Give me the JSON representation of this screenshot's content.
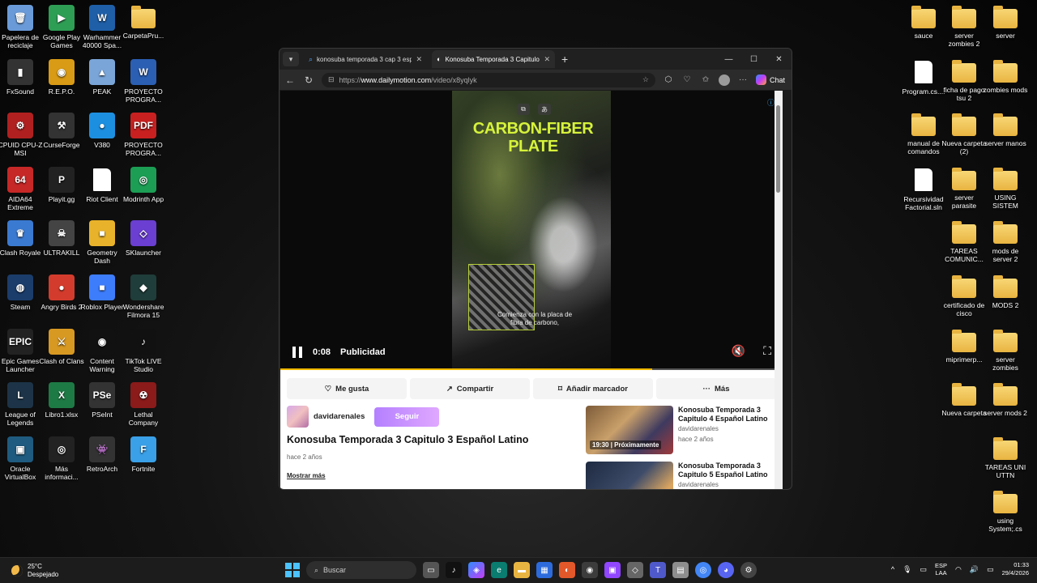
{
  "desktop_left": [
    {
      "label": "Papelera de reciclaje",
      "color": "#6a9bd8",
      "glyph": "🗑"
    },
    {
      "label": "Google Play Games",
      "color": "#2f9e55",
      "glyph": "▶"
    },
    {
      "label": "Warhammer 40000 Spa...",
      "color": "#1f5fa8",
      "glyph": "W"
    },
    {
      "label": "CarpetaPru...",
      "color": "folder",
      "glyph": ""
    },
    {
      "label": "FxSound",
      "color": "#333",
      "glyph": "▮"
    },
    {
      "label": "R.E.P.O.",
      "color": "#d99b16",
      "glyph": "◉"
    },
    {
      "label": "PEAK",
      "color": "#7aa5d8",
      "glyph": "▲"
    },
    {
      "label": "PROYECTO PROGRA...",
      "color": "#2b5fb3",
      "glyph": "W"
    },
    {
      "label": "CPUID CPU-Z MSI",
      "color": "#b02020",
      "glyph": "⚙"
    },
    {
      "label": "CurseForge",
      "color": "#333",
      "glyph": "⚒"
    },
    {
      "label": "V380",
      "color": "#1d8fe0",
      "glyph": "●"
    },
    {
      "label": "PROYECTO PROGRA...",
      "color": "#c82020",
      "glyph": "PDF"
    },
    {
      "label": "AIDA64 Extreme",
      "color": "#c62828",
      "glyph": "64"
    },
    {
      "label": "Playit.gg",
      "color": "#222",
      "glyph": "P"
    },
    {
      "label": "Riot Client",
      "color": "#fff",
      "glyph": ""
    },
    {
      "label": "Modrinth App",
      "color": "#1c9e55",
      "glyph": "◎"
    },
    {
      "label": "Clash Royale",
      "color": "#3b7ad1",
      "glyph": "♛"
    },
    {
      "label": "ULTRAKILL",
      "color": "#444",
      "glyph": "☠"
    },
    {
      "label": "Geometry Dash",
      "color": "#e8b32b",
      "glyph": "■"
    },
    {
      "label": "SKlauncher",
      "color": "#6a3fd1",
      "glyph": "◇"
    },
    {
      "label": "Steam",
      "color": "#1b3d6b",
      "glyph": "◍"
    },
    {
      "label": "Angry Birds 2",
      "color": "#d33c2c",
      "glyph": "●"
    },
    {
      "label": "Roblox Player",
      "color": "#3d7dfc",
      "glyph": "■"
    },
    {
      "label": "Wondershare Filmora 15",
      "color": "#1f3d3a",
      "glyph": "◆"
    },
    {
      "label": "Epic Games Launcher",
      "color": "#222",
      "glyph": "EPIC"
    },
    {
      "label": "Clash of Clans",
      "color": "#d89922",
      "glyph": "⚔"
    },
    {
      "label": "Content Warning",
      "color": "#111",
      "glyph": "◉"
    },
    {
      "label": "TikTok LIVE Studio",
      "color": "#111",
      "glyph": "♪"
    },
    {
      "label": "League of Legends",
      "color": "#1d3448",
      "glyph": "L"
    },
    {
      "label": "Libro1.xlsx",
      "color": "#1e7a45",
      "glyph": "X"
    },
    {
      "label": "PSeInt",
      "color": "#333",
      "glyph": "PSe"
    },
    {
      "label": "Lethal Company",
      "color": "#8b1a1a",
      "glyph": "☢"
    },
    {
      "label": "Oracle VirtualBox",
      "color": "#1f5b80",
      "glyph": "▣"
    },
    {
      "label": "Más informaci...",
      "color": "#222",
      "glyph": "◎"
    },
    {
      "label": "RetroArch",
      "color": "#333",
      "glyph": "👾"
    },
    {
      "label": "Fortnite",
      "color": "#3aa0e8",
      "glyph": "F"
    }
  ],
  "desktop_right": [
    {
      "label": "sauce",
      "type": "folder"
    },
    {
      "label": "server zombies 2",
      "type": "folder"
    },
    {
      "label": "server",
      "type": "folder"
    },
    {
      "label": "Program.cs....",
      "type": "file"
    },
    {
      "label": "ficha de pago tsu 2",
      "type": "folder"
    },
    {
      "label": "zombies mods",
      "type": "folder"
    },
    {
      "label": "manual de comandos",
      "type": "folder"
    },
    {
      "label": "Nueva carpeta (2)",
      "type": "folder"
    },
    {
      "label": "server manos",
      "type": "folder"
    },
    {
      "label": "Recursividad Factorial.sln",
      "type": "file"
    },
    {
      "label": "server parasite",
      "type": "folder"
    },
    {
      "label": "USING SISTEM",
      "type": "folder"
    },
    {
      "label": "TAREAS COMUNIC...",
      "type": "folder"
    },
    {
      "label": "mods de server 2",
      "type": "folder"
    },
    {
      "label": "certificado de cisco",
      "type": "folder"
    },
    {
      "label": "MODS 2",
      "type": "folder"
    },
    {
      "label": "miprimerp...",
      "type": "folder"
    },
    {
      "label": "server zombies",
      "type": "folder"
    },
    {
      "label": "Nueva carpeta",
      "type": "folder"
    },
    {
      "label": "server mods 2",
      "type": "folder"
    },
    {
      "label": "TAREAS UNI UTTN",
      "type": "folder"
    },
    {
      "label": "using System;.cs",
      "type": "folder"
    }
  ],
  "browser": {
    "tabs": [
      {
        "label": "konosuba temporada 3 cap 3 espa"
      },
      {
        "label": "Konosuba Temporada 3 Capitulo 3"
      }
    ],
    "url_prefix": "https://",
    "url_host": "www.dailymotion.com",
    "url_path": "/video/x8yqlyk",
    "chat_label": "Chat"
  },
  "player": {
    "overlay_title": "CARBON-FIBER PLATE",
    "overlay_caption": "Comienza con la placa de fibra de carbono,",
    "time": "0:08",
    "ad_label": "Publicidad",
    "progress": 0.74
  },
  "page": {
    "actions": [
      "Me gusta",
      "Compartir",
      "Añadir marcador",
      "Más"
    ],
    "owner": "davidarenales",
    "follow": "Seguir",
    "title": "Konosuba Temporada 3 Capitulo 3 Español Latino",
    "date": "hace 2 años",
    "show_more": "Mostrar más",
    "related": [
      {
        "title": "Konosuba Temporada 3 Capitulo 4 Español Latino",
        "owner": "davidarenales",
        "date": "hace 2 años",
        "duration": "19:30",
        "badge": "Próximamente"
      },
      {
        "title": "Konosuba Temporada 3 Capitulo 5 Español Latino",
        "owner": "davidarenales",
        "date": "",
        "duration": "",
        "badge": ""
      }
    ]
  },
  "taskbar": {
    "temp": "25°C",
    "weather": "Despejado",
    "search": "Buscar",
    "lang1": "ESP",
    "lang2": "LAA",
    "time": "01:33",
    "date": "29/4/2026"
  }
}
